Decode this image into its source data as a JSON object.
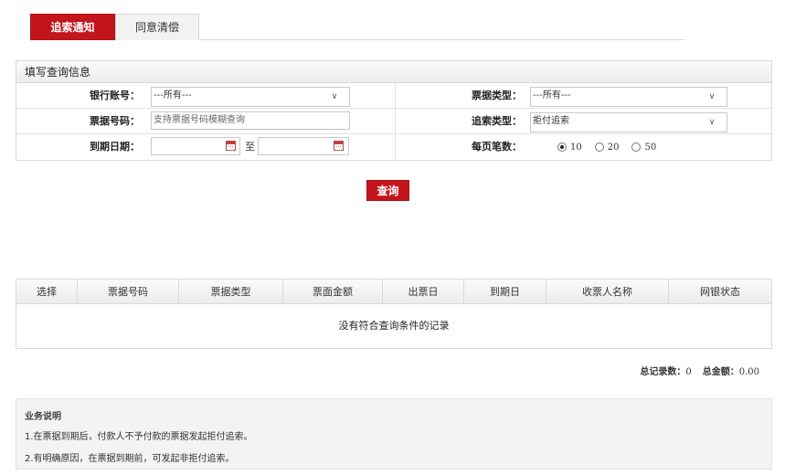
{
  "tabs": [
    {
      "label": "追索通知",
      "active": true
    },
    {
      "label": "同意清偿",
      "active": false
    }
  ],
  "query_panel": {
    "title": "填写查询信息",
    "bank_account": {
      "label": "银行账号：",
      "value": "---所有---"
    },
    "bill_type": {
      "label": "票据类型：",
      "value": "---所有---"
    },
    "bill_number": {
      "label": "票据号码：",
      "placeholder": "支持票据号码模糊查询"
    },
    "recourse_type": {
      "label": "追索类型：",
      "value": "拒付追索"
    },
    "due_date": {
      "label": "到期日期：",
      "to": "至"
    },
    "page_size": {
      "label": "每页笔数：",
      "options": [
        "10",
        "20",
        "50"
      ],
      "selected": "10"
    },
    "query_button": "查询"
  },
  "results": {
    "columns": [
      "选择",
      "票据号码",
      "票据类型",
      "票面金额",
      "出票日",
      "到期日",
      "收票人名称",
      "网银状态"
    ],
    "empty_text": "没有符合查询条件的记录"
  },
  "totals": {
    "count_label": "总记录数：",
    "count": "0",
    "amount_label": "总金额：",
    "amount": "0.00"
  },
  "notes": {
    "title": "业务说明",
    "lines": [
      "1.在票据到期后，付款人不予付款的票据发起拒付追索。",
      "2.有明确原因，在票据到期前，可发起非拒付追索。"
    ]
  },
  "colors": {
    "accent": "#c4151c"
  },
  "icons": {
    "select_chevron": "chevron-down-icon",
    "date_picker": "calendar-icon"
  }
}
